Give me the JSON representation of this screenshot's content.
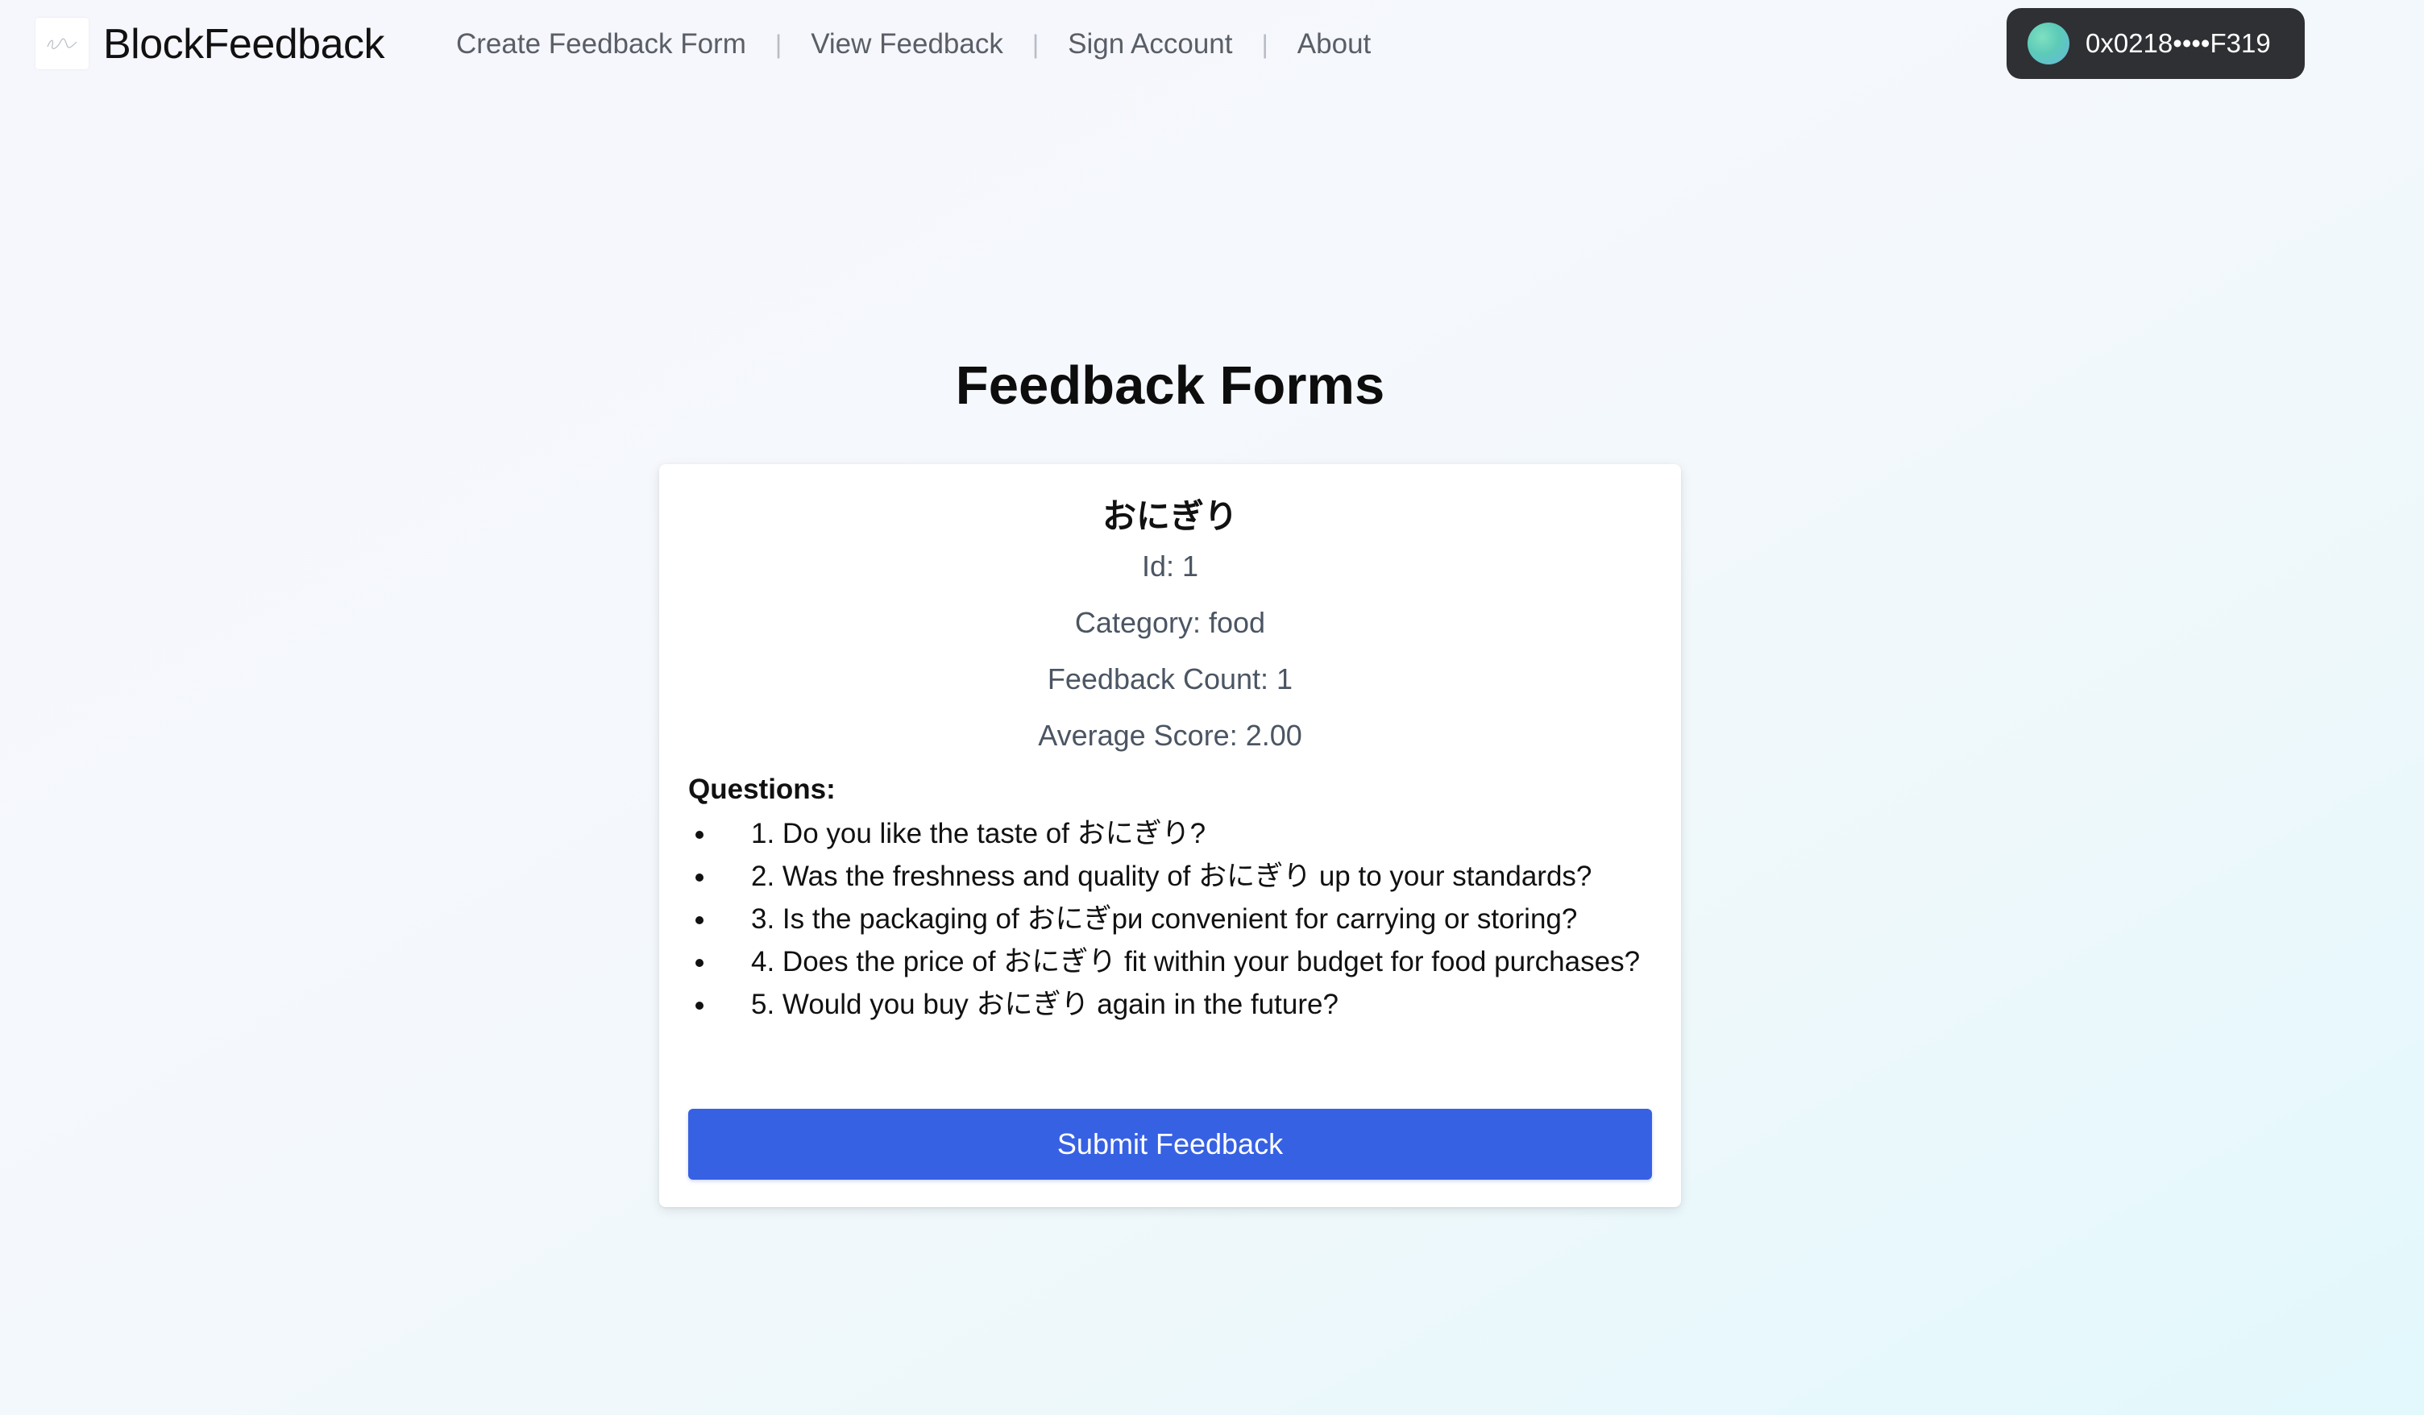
{
  "nav": {
    "brand": "BlockFeedback",
    "links": [
      {
        "label": "Create Feedback Form"
      },
      {
        "label": "View Feedback"
      },
      {
        "label": "Sign Account"
      },
      {
        "label": "About"
      }
    ],
    "separator": "|",
    "wallet": {
      "address": "0x0218••••F319",
      "avatar_colors": [
        "#7fe0c0",
        "#5ccab8",
        "#67b8e0"
      ]
    }
  },
  "page": {
    "title": "Feedback Forms"
  },
  "form": {
    "name": "おにぎり",
    "id_line": "Id: 1",
    "category_line": "Category: food",
    "feedback_count_line": "Feedback Count: 1",
    "average_score_line": "Average Score: 2.00",
    "questions_heading": "Questions:",
    "questions": [
      "1. Do you like the taste of おにぎり?",
      "2. Was the freshness and quality of おにぎり up to your standards?",
      "3. Is the packaging of おにぎри convenient for carrying or storing?",
      "4. Does the price of おにぎり fit within your budget for food purchases?",
      "5. Would you buy おにぎり again in the future?"
    ],
    "submit_label": "Submit Feedback"
  },
  "colors": {
    "accent": "#3761e3",
    "wallet_bg": "#2f3033",
    "nav_text": "#5a5e66",
    "meta_text": "#4b5563"
  }
}
